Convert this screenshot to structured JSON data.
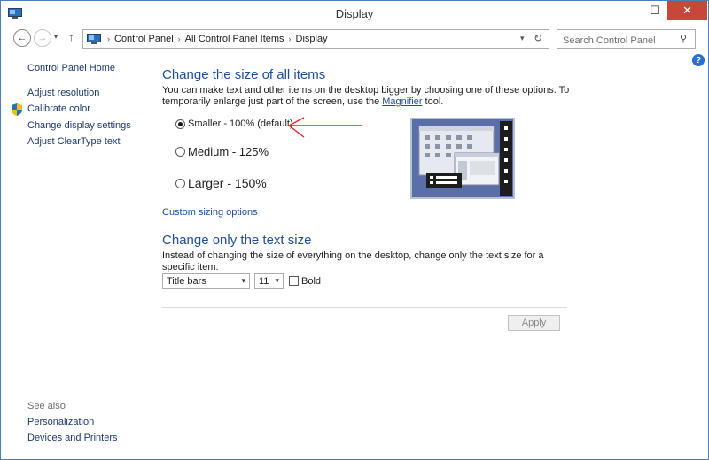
{
  "window": {
    "title": "Display",
    "minimize_glyph": "—",
    "maximize_glyph": "☐",
    "close_glyph": "✕"
  },
  "nav": {
    "back_glyph": "←",
    "forward_glyph": "→",
    "recent_glyph": "▾",
    "up_glyph": "↑",
    "breadcrumbs": [
      "Control Panel",
      "All Control Panel Items",
      "Display"
    ],
    "breadcrumb_sep": "›",
    "dropdown_glyph": "▾",
    "refresh_glyph": "↻",
    "search_placeholder": "Search Control Panel",
    "search_glyph": "⚲"
  },
  "help_glyph": "?",
  "sidebar": {
    "home": "Control Panel Home",
    "items": [
      "Adjust resolution",
      "Calibrate color",
      "Change display settings",
      "Adjust ClearType text"
    ],
    "see_also_label": "See also",
    "see_also": [
      "Personalization",
      "Devices and Printers"
    ]
  },
  "main": {
    "size_heading": "Change the size of all items",
    "size_desc_prefix": "You can make text and other items on the desktop bigger by choosing one of these options. To temporarily enlarge just part of the screen, use the ",
    "magnifier_link": "Magnifier",
    "size_desc_suffix": " tool.",
    "options": [
      {
        "label": "Smaller - 100% (default)",
        "selected": true
      },
      {
        "label": "Medium - 125%",
        "selected": false
      },
      {
        "label": "Larger - 150%",
        "selected": false
      }
    ],
    "custom_link": "Custom sizing options",
    "text_heading": "Change only the text size",
    "text_desc": "Instead of changing the size of everything on the desktop, change only the text size for a specific item.",
    "item_select": {
      "value": "Title bars",
      "arrow": "▾"
    },
    "size_select": {
      "value": "11",
      "arrow": "▾"
    },
    "bold_label": "Bold",
    "bold_checked": false,
    "apply_label": "Apply"
  },
  "colors": {
    "link": "#1f4e99",
    "close_button": "#c7483a",
    "preview_bg": "#5a6ea8",
    "annotation_arrow": "#e0282e"
  }
}
